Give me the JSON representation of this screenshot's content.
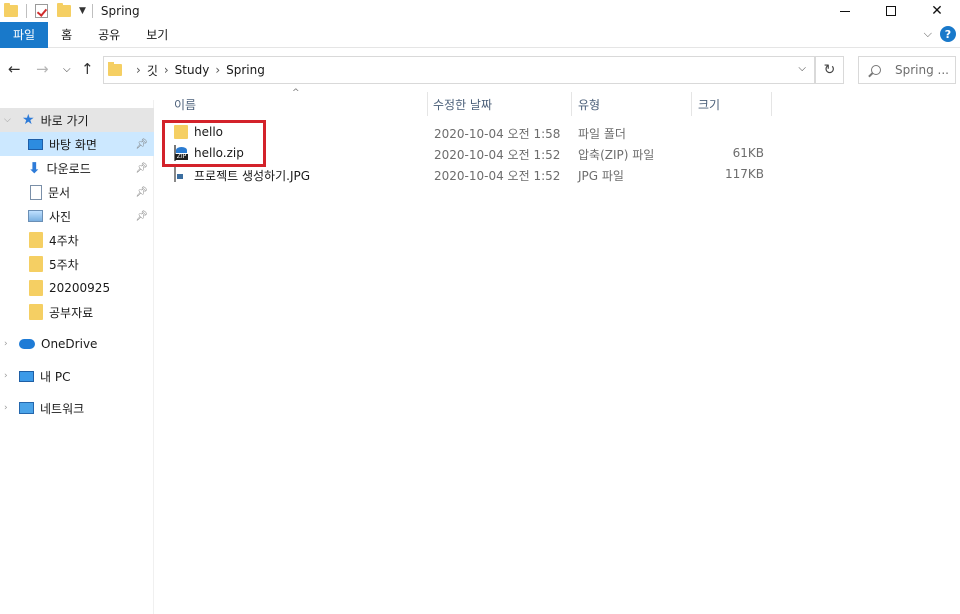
{
  "window": {
    "title": "Spring"
  },
  "ribbon": {
    "tabs": [
      "파일",
      "홈",
      "공유",
      "보기"
    ]
  },
  "address": {
    "crumbs": [
      "깃",
      "Study",
      "Spring"
    ],
    "search_placeholder": "Spring ..."
  },
  "sidebar": {
    "items": [
      {
        "label": "바로 가기",
        "icon": "star-icon"
      },
      {
        "label": "바탕 화면",
        "icon": "desktop-icon"
      },
      {
        "label": "다운로드",
        "icon": "download-icon"
      },
      {
        "label": "문서",
        "icon": "document-icon"
      },
      {
        "label": "사진",
        "icon": "pictures-icon"
      },
      {
        "label": "4주차",
        "icon": "folder-icon"
      },
      {
        "label": "5주차",
        "icon": "folder-icon"
      },
      {
        "label": "20200925",
        "icon": "folder-icon"
      },
      {
        "label": "공부자료",
        "icon": "folder-icon"
      },
      {
        "label": "OneDrive",
        "icon": "cloud-icon"
      },
      {
        "label": "내 PC",
        "icon": "pc-icon"
      },
      {
        "label": "네트워크",
        "icon": "network-icon"
      }
    ]
  },
  "columns": {
    "name": "이름",
    "date": "수정한 날짜",
    "type": "유형",
    "size": "크기"
  },
  "files": [
    {
      "name": "hello",
      "date": "2020-10-04 오전 1:58",
      "type": "파일 폴더",
      "size": "",
      "icon": "folder-icon"
    },
    {
      "name": "hello.zip",
      "date": "2020-10-04 오전 1:52",
      "type": "압축(ZIP) 파일",
      "size": "61KB",
      "icon": "zip-icon"
    },
    {
      "name": "프로젝트 생성하기.JPG",
      "date": "2020-10-04 오전 1:52",
      "type": "JPG 파일",
      "size": "117KB",
      "icon": "image-file-icon"
    }
  ],
  "colors": {
    "accent": "#1979ca",
    "highlight": "#d3222a",
    "folder": "#f5cf63"
  }
}
